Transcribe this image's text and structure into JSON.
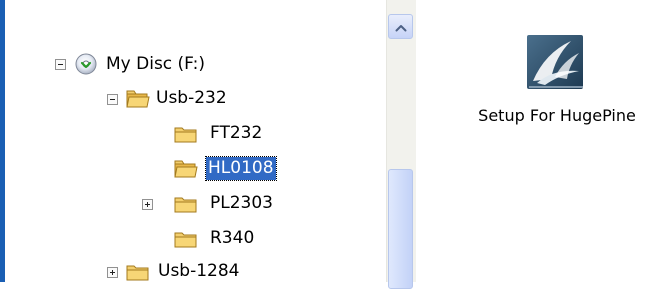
{
  "tree": {
    "nodes": [
      {
        "label": "My Disc (F:)",
        "expander": "minus",
        "icon": "disc-icon"
      },
      {
        "label": "Usb-232",
        "expander": "minus",
        "icon": "folder-open-icon"
      },
      {
        "label": "FT232",
        "expander": "none",
        "icon": "folder-icon"
      },
      {
        "label": "HL0108",
        "expander": "none",
        "icon": "folder-open-icon",
        "selected": true
      },
      {
        "label": "PL2303",
        "expander": "plus",
        "icon": "folder-icon"
      },
      {
        "label": "R340",
        "expander": "none",
        "icon": "folder-icon"
      },
      {
        "label": "Usb-1284",
        "expander": "plus",
        "icon": "folder-icon"
      }
    ]
  },
  "scrollbar": {
    "up_icon": "scroll-up-arrow-icon"
  },
  "desktop_shortcut": {
    "label": "Setup For HugePine",
    "icon": "setup-app-icon"
  },
  "colors": {
    "selection": "#316ac5",
    "folder_fill": "#f7d676",
    "left_edge": "#1a5fb4"
  }
}
